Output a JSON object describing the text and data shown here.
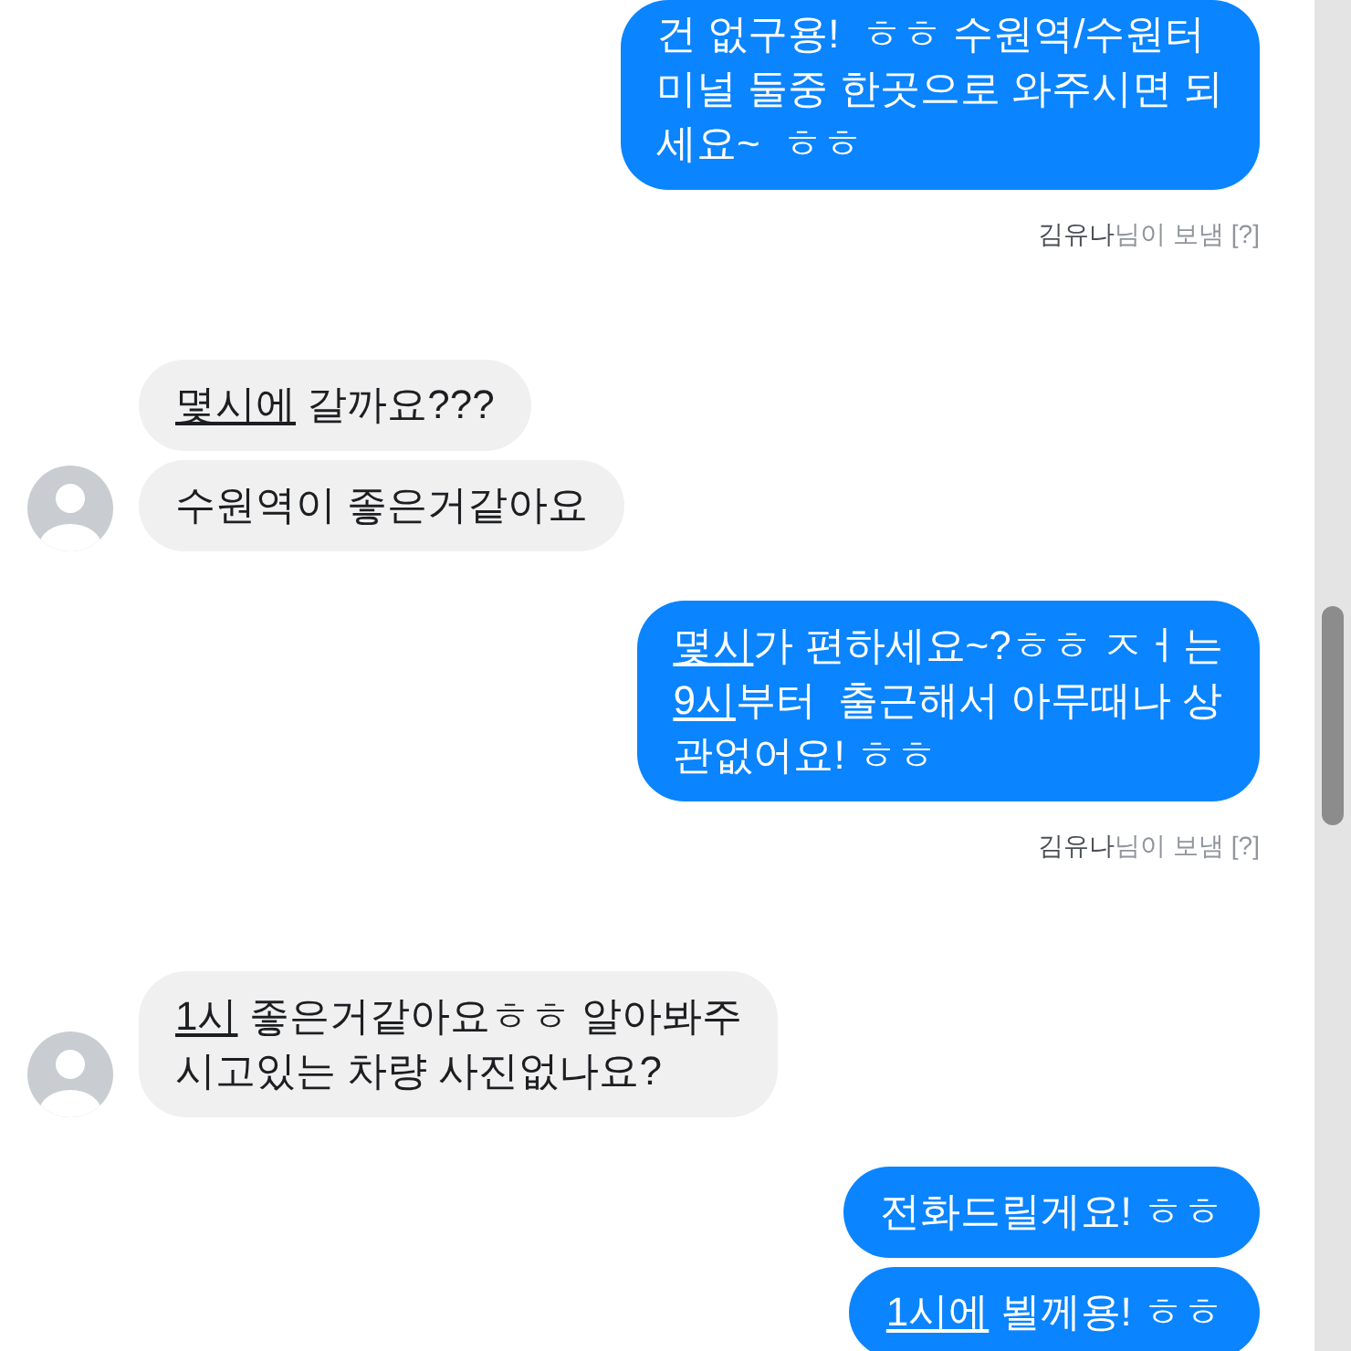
{
  "messages": [
    {
      "kind": "outgoing",
      "bubbles": [
        {
          "lines": [
            [
              {
                "text": "건 없구용!  ㅎㅎ 수원역/수원터",
                "link": false
              }
            ],
            [
              {
                "text": "미널 둘중 한곳으로 와주시면 되",
                "link": false
              }
            ],
            [
              {
                "text": "세요~  ㅎㅎ",
                "link": false
              }
            ]
          ]
        }
      ],
      "sender_note": "**김유나**님이 보냄 [?]"
    },
    {
      "kind": "incoming",
      "bubbles": [
        {
          "lines": [
            [
              {
                "text": "몇시에",
                "link": true
              },
              {
                "text": " 갈까요???",
                "link": false
              }
            ]
          ]
        },
        {
          "lines": [
            [
              {
                "text": "수원역이 좋은거같아요",
                "link": false
              }
            ]
          ]
        }
      ]
    },
    {
      "kind": "outgoing",
      "bubbles": [
        {
          "lines": [
            [
              {
                "text": "몇시",
                "link": true
              },
              {
                "text": "가 편하세요~?ㅎㅎ ㅈㅓ는",
                "link": false
              }
            ],
            [
              {
                "text": "9시",
                "link": true
              },
              {
                "text": "부터  출근해서 아무때나 상",
                "link": false
              }
            ],
            [
              {
                "text": "관없어요! ㅎㅎ",
                "link": false
              }
            ]
          ]
        }
      ],
      "sender_note": "**김유나**님이 보냄 [?]"
    },
    {
      "kind": "incoming",
      "bubbles": [
        {
          "lines": [
            [
              {
                "text": "1시",
                "link": true
              },
              {
                "text": " 좋은거같아요ㅎㅎ 알아봐주",
                "link": false
              }
            ],
            [
              {
                "text": "시고있는 차량 사진없나요?",
                "link": false
              }
            ]
          ]
        }
      ]
    },
    {
      "kind": "outgoing",
      "bubbles": [
        {
          "lines": [
            [
              {
                "text": "전화드릴게요! ㅎㅎ",
                "link": false
              }
            ]
          ]
        },
        {
          "lines": [
            [
              {
                "text": "1시에",
                "link": true
              },
              {
                "text": " 뵐께용! ㅎㅎ",
                "link": false
              }
            ]
          ]
        }
      ]
    }
  ]
}
